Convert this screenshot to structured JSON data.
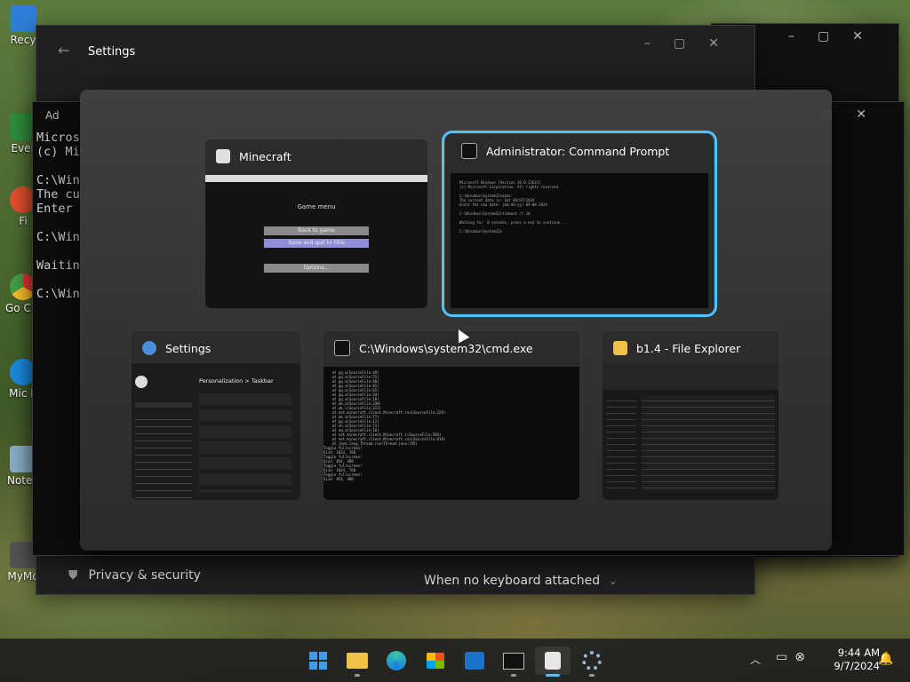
{
  "desktop": {
    "icons": [
      {
        "label": "Recy",
        "color": "#2f7fd8"
      },
      {
        "label": "Ever",
        "color": "#2f8f3e"
      },
      {
        "label": "Fi",
        "color": "#e2502e"
      },
      {
        "label": "Go Chr",
        "color": "#e5b62b"
      },
      {
        "label": "Mic E",
        "color": "#1c8be0"
      },
      {
        "label": "Notep",
        "color": "#8ab0c8"
      },
      {
        "label": "MyMo",
        "color": "#555555"
      }
    ]
  },
  "bg_settings": {
    "title": "Settings",
    "privacy_label": "Privacy & security",
    "keyboard_value": "When no keyboard attached"
  },
  "bg_cmd": {
    "title": "Ad",
    "lines": [
      "Micros",
      "(c) Mi",
      "",
      "C:\\Win",
      "The cu",
      "Enter",
      "",
      "C:\\Win",
      "",
      "Waitin",
      "",
      "C:\\Win"
    ]
  },
  "switcher": {
    "cards": [
      {
        "id": "minecraft",
        "title": "Minecraft",
        "icon": "java-icon",
        "selected": false,
        "thumb": {
          "menu_title": "Game menu",
          "btn1": "Back to game",
          "btn2": "Save and quit to title",
          "btn3": "Options..."
        }
      },
      {
        "id": "admin-cmd",
        "title": "Administrator: Command Prompt",
        "icon": "cmd-icon",
        "selected": true
      },
      {
        "id": "settings",
        "title": "Settings",
        "icon": "gear-icon",
        "selected": false,
        "thumb": {
          "heading": "Personalization  >  Taskbar"
        }
      },
      {
        "id": "cmd",
        "title": "C:\\Windows\\system32\\cmd.exe",
        "icon": "cmd-icon",
        "selected": false
      },
      {
        "id": "explorer",
        "title": "b1.4 - File Explorer",
        "icon": "folder-icon",
        "selected": false
      }
    ]
  },
  "taskbar": {
    "apps": [
      {
        "name": "start",
        "icon": "windows-logo-icon"
      },
      {
        "name": "file-explorer",
        "icon": "folder-icon"
      },
      {
        "name": "edge",
        "icon": "edge-icon"
      },
      {
        "name": "store",
        "icon": "store-icon"
      },
      {
        "name": "outlook",
        "icon": "outlook-icon"
      },
      {
        "name": "terminal",
        "icon": "cmd-icon"
      },
      {
        "name": "java",
        "icon": "java-icon"
      },
      {
        "name": "settings",
        "icon": "gear-icon"
      }
    ],
    "time": "9:44 AM",
    "date": "9/7/2024"
  },
  "colors": {
    "accent": "#4cc2ff",
    "selected_outline": "#4cc2ff"
  }
}
